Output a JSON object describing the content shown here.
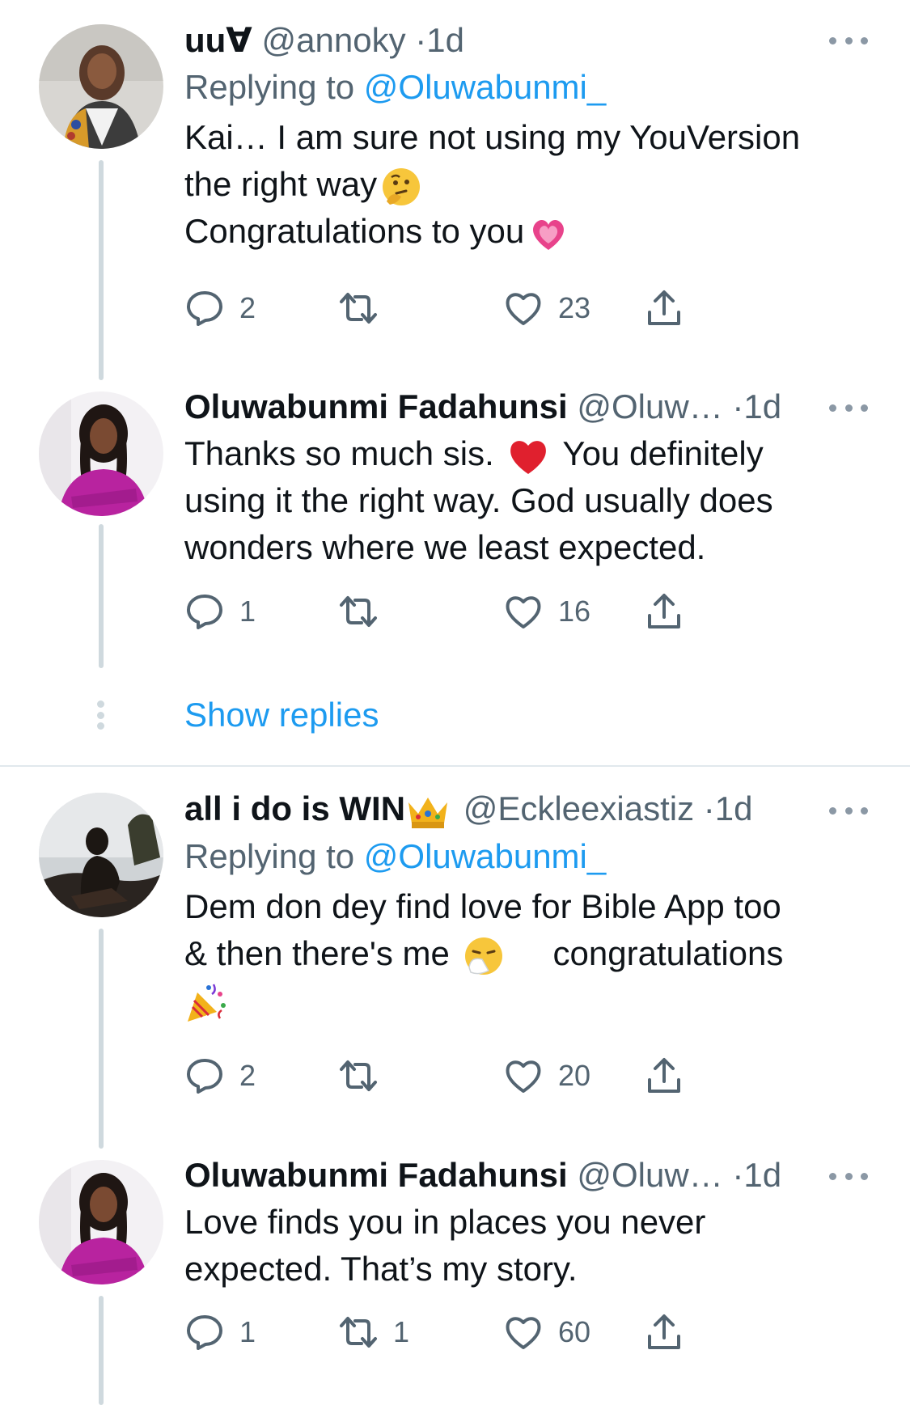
{
  "tweets": [
    {
      "name": "uu∀",
      "handle": "@annoky",
      "dot": "·",
      "time": "1d",
      "replying_prefix": "Replying to ",
      "replying_to": "@Oluwabunmi_",
      "lines": [
        "Kai… I am sure not using my YouVersion",
        "the right way",
        "Congratulations to you"
      ],
      "replies": "2",
      "retweets": "",
      "likes": "23"
    },
    {
      "name": "Oluwabunmi Fadahunsi",
      "handle": "@Oluw…",
      "dot": "·",
      "time": "1d",
      "lines": [
        "Thanks so much sis.",
        "You definitely",
        "using it the right way. God usually does",
        "wonders where we least expected."
      ],
      "replies": "1",
      "retweets": "",
      "likes": "16"
    },
    {
      "name": "all i do is WIN",
      "handle": "@Eckleexiastiz",
      "dot": "·",
      "time": "1d",
      "replying_prefix": "Replying to ",
      "replying_to": "@Oluwabunmi_",
      "lines": [
        "Dem don dey find love for Bible App too",
        "& then there's me",
        "congratulations"
      ],
      "replies": "2",
      "retweets": "",
      "likes": "20"
    },
    {
      "name": "Oluwabunmi Fadahunsi",
      "handle": "@Oluw…",
      "dot": "·",
      "time": "1d",
      "lines": [
        "Love finds you in places you never",
        "expected. That’s my story."
      ],
      "replies": "1",
      "retweets": "1",
      "likes": "60"
    }
  ],
  "show_replies": "Show replies",
  "colors": {
    "accent": "#1d9bf0",
    "secondary_text": "#536471",
    "primary_text": "#0f1419",
    "thread_line": "#cfd9de"
  },
  "icons": [
    "reply-icon",
    "retweet-icon",
    "like-icon",
    "share-icon",
    "more-icon"
  ]
}
